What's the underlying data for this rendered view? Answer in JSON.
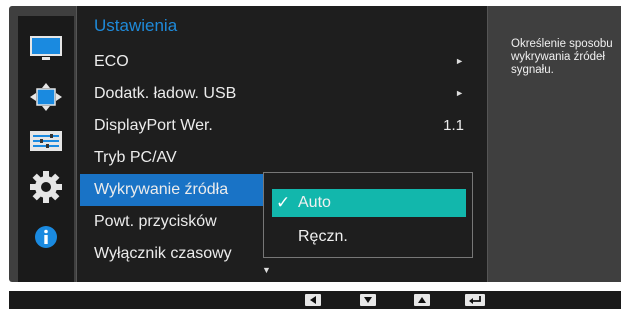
{
  "menu": {
    "title": "Ustawienia",
    "items": [
      {
        "label": "ECO",
        "indicator": "►"
      },
      {
        "label": "Dodatk. ładow. USB",
        "indicator": "►"
      },
      {
        "label": "DisplayPort Wer.",
        "value": "1.1"
      },
      {
        "label": "Tryb PC/AV"
      },
      {
        "label": "Wykrywanie źródła",
        "selected": true
      },
      {
        "label": "Powt. przycisków"
      },
      {
        "label": "Wyłącznik czasowy"
      }
    ],
    "scroll_indicator": "▼"
  },
  "submenu": {
    "options": [
      {
        "label": "Auto",
        "checked": true,
        "check_glyph": "✓"
      },
      {
        "label": "Ręczn.",
        "checked": false
      }
    ]
  },
  "help": {
    "text": "Określenie sposobu wykrywania źródeł sygnału."
  },
  "side_icons": [
    "monitor-icon",
    "position-arrows-icon",
    "settings-bars-icon",
    "gear-icon",
    "info-icon"
  ],
  "nav_buttons": [
    {
      "name": "left-arrow-button",
      "glyph": "◄"
    },
    {
      "name": "down-arrow-button",
      "glyph": "▼"
    },
    {
      "name": "up-arrow-button",
      "glyph": "▲"
    },
    {
      "name": "enter-button",
      "glyph": "↵"
    }
  ],
  "colors": {
    "accent_blue": "#1973c6",
    "title_blue": "#1f8ad9",
    "submenu_teal": "#12b7ac"
  }
}
